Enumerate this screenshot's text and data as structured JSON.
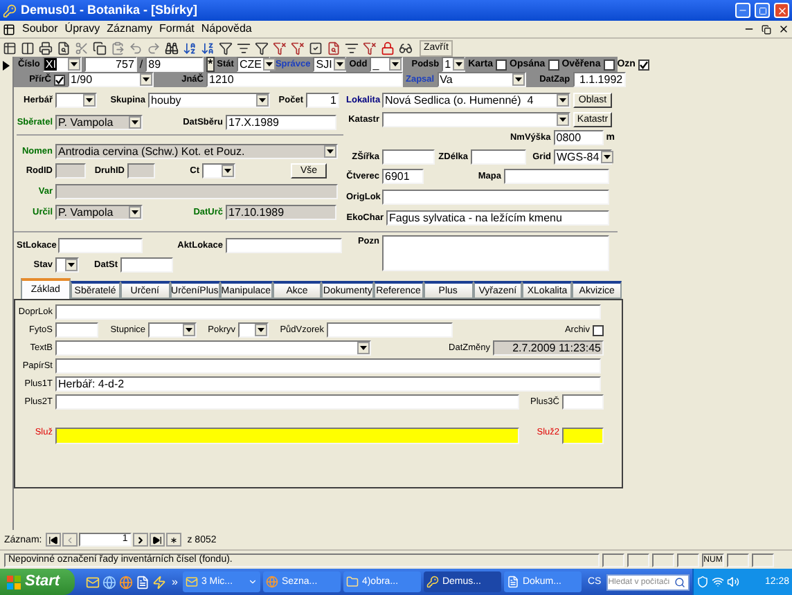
{
  "window": {
    "title": "Demus01 - Botanika - [Sbírky]"
  },
  "menu": [
    "Soubor",
    "Úpravy",
    "Záznamy",
    "Formát",
    "Nápověda"
  ],
  "toolbar": {
    "close": "Zavřít"
  },
  "header": {
    "cislo": {
      "label": "Číslo"
    },
    "prefix": {
      "kind": "combo",
      "value": "XI",
      "highlighted": true
    },
    "number": {
      "kind": "text",
      "value": "757"
    },
    "slash": "/",
    "suffix": {
      "kind": "text",
      "value": "89"
    },
    "star": "*",
    "stat": {
      "label": "Stát",
      "kind": "combo",
      "value": "CZE"
    },
    "spravce": {
      "label": "Správce",
      "kind": "combo",
      "value": "SJI",
      "color": "#1c3fbf"
    },
    "odd": {
      "label": "Odd",
      "kind": "combo",
      "value": "_"
    },
    "podsb": {
      "label": "Podsb",
      "kind": "combo",
      "value": "1"
    },
    "flags": [
      {
        "label": "Karta",
        "checked": false
      },
      {
        "label": "Opsána",
        "checked": false
      },
      {
        "label": "Ověřena",
        "checked": false
      },
      {
        "label": "Ozn",
        "checked": true
      }
    ],
    "pric": {
      "label": "PřírČ",
      "checked": true,
      "kind": "combo",
      "value": "1/90"
    },
    "jnac": {
      "label": "JnáČ",
      "kind": "text",
      "value": "1210"
    },
    "zapsal": {
      "label": "Zapsal",
      "kind": "combo",
      "value": "Va",
      "color": "#1c3fbf"
    },
    "datzap": {
      "label": "DatZap",
      "kind": "text",
      "value": "1.1.1992"
    }
  },
  "main": {
    "herbar": {
      "label": "Herbář",
      "kind": "combo"
    },
    "skupina": {
      "label": "Skupina",
      "kind": "combo",
      "value": "houby"
    },
    "pocet": {
      "label": "Počet",
      "kind": "text",
      "value": "1"
    },
    "sberatel": {
      "label": "Sběratel",
      "kind": "readonly_combo",
      "value": "P. Vampola",
      "color": "#007000"
    },
    "datsberu": {
      "label": "DatSběru",
      "kind": "text",
      "value": "17.X.1989"
    },
    "nomen": {
      "label": "Nomen",
      "kind": "readonly_combo",
      "value": "Antrodia cervina (Schw.) Kot. et Pouz.",
      "color": "#007000"
    },
    "rodid": {
      "label": "RodID",
      "kind": "readonly"
    },
    "druhid": {
      "label": "DruhID",
      "kind": "readonly"
    },
    "ct": {
      "label": "Ct",
      "kind": "combo"
    },
    "vse": "Vše",
    "var": {
      "label": "Var",
      "kind": "readonly",
      "color": "#007000"
    },
    "urcil": {
      "label": "Určil",
      "kind": "readonly_combo",
      "value": "P. Vampola",
      "color": "#007000"
    },
    "daturc": {
      "label": "DatUrč",
      "kind": "readonly",
      "value": "17.10.1989",
      "color": "#007000"
    },
    "stlokace": {
      "label": "StLokace",
      "kind": "text"
    },
    "aktlokace": {
      "label": "AktLokace",
      "kind": "text"
    },
    "stav": {
      "label": "Stav",
      "kind": "combo"
    },
    "datst": {
      "label": "DatSt",
      "kind": "text"
    },
    "lokalita": {
      "label": "Lokalita",
      "kind": "combo",
      "value": "Nová Sedlica (o. Humenné)  4",
      "color": "#000080"
    },
    "oblast": "Oblast",
    "katastr": {
      "label": "Katastr",
      "kind": "combo"
    },
    "katastr_button": "Katastr",
    "nmvyska": {
      "label": "NmVýška",
      "kind": "text",
      "value": "0800"
    },
    "nmvyska_unit": "m",
    "zsirka": {
      "label": "ZŠířka",
      "kind": "text"
    },
    "zdelka": {
      "label": "ZDélka",
      "kind": "text"
    },
    "grid": {
      "label": "Grid",
      "kind": "combo",
      "value": "WGS-84"
    },
    "ctverec": {
      "label": "Čtverec",
      "kind": "text",
      "value": "6901"
    },
    "mapa": {
      "label": "Mapa",
      "kind": "text"
    },
    "origlok": {
      "label": "OrigLok",
      "kind": "text"
    },
    "ekochar": {
      "label": "EkoChar",
      "kind": "text",
      "value": "Fagus sylvatica - na ležícím kmenu"
    },
    "pozn": {
      "label": "Pozn",
      "kind": "text"
    }
  },
  "tabs": [
    {
      "label": "Základ",
      "selected": true
    },
    {
      "label": "Sběratelé",
      "selected": false
    },
    {
      "label": "Určení",
      "selected": false
    },
    {
      "label": "UrčeníPlus",
      "selected": false
    },
    {
      "label": "Manipulace",
      "selected": false
    },
    {
      "label": "Akce",
      "selected": false
    },
    {
      "label": "Dokumenty",
      "selected": false
    },
    {
      "label": "Reference",
      "selected": false
    },
    {
      "label": "Plus",
      "selected": false
    },
    {
      "label": "Vyřazení",
      "selected": false
    },
    {
      "label": "XLokalita",
      "selected": false
    },
    {
      "label": "Akvizice",
      "selected": false
    }
  ],
  "panel": {
    "doprlok": {
      "label": "DoprLok",
      "kind": "text"
    },
    "fytos": {
      "label": "FytoS",
      "kind": "text"
    },
    "stupnice": {
      "label": "Stupnice",
      "kind": "combo"
    },
    "pokryv": {
      "label": "Pokryv",
      "kind": "combo"
    },
    "pudvzorek": {
      "label": "PůdVzorek",
      "kind": "text"
    },
    "archiv": {
      "label": "Archiv",
      "checked": false
    },
    "textb": {
      "label": "TextB",
      "kind": "combo"
    },
    "datzmeny": {
      "label": "DatZměny",
      "kind": "readonly",
      "value": "2.7.2009 11:23:45"
    },
    "papirst": {
      "label": "PapírSt",
      "kind": "text"
    },
    "plus1t": {
      "label": "Plus1T",
      "kind": "text",
      "value": "Herbář: 4-d-2"
    },
    "plus2t": {
      "label": "Plus2T",
      "kind": "text"
    },
    "plus3c": {
      "label": "Plus3Č",
      "kind": "text"
    },
    "sluz": {
      "label": "Služ",
      "kind": "highlight",
      "color": "#e00000"
    },
    "sluz2": {
      "label": "Služ2",
      "kind": "highlight",
      "color": "#e00000"
    }
  },
  "navigator": {
    "label": "Záznam:",
    "record": "1",
    "total": "z 8052"
  },
  "status_bar": {
    "message": "Nepovinné označení řady inventárních čísel (fondu).",
    "indicator": "NUM"
  },
  "taskbar": {
    "start": "Start",
    "overflow": "»",
    "tasks": [
      {
        "label": "3 Mic...",
        "grouped": true,
        "selected": false
      },
      {
        "label": "Sezna...",
        "grouped": false,
        "selected": false
      },
      {
        "label": "4)obra...",
        "grouped": false,
        "selected": false
      },
      {
        "label": "Demus...",
        "grouped": false,
        "selected": true
      },
      {
        "label": "Dokum...",
        "grouped": false,
        "selected": false
      }
    ],
    "language": "CS",
    "search_placeholder": "Hledat v počítači",
    "clock": "12:28"
  }
}
